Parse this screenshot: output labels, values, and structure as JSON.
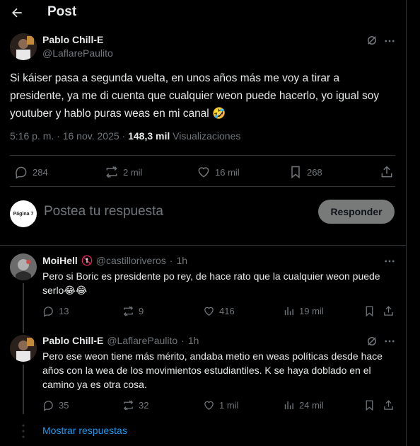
{
  "header": {
    "title": "Post"
  },
  "post": {
    "author_name": "Pablo Chill-E",
    "author_handle": "@LaflarePaulito",
    "text": "Si káiser pasa a segunda vuelta, en unos años más me voy a tirar a presidente, ya me di cuenta que cualquier weon puede hacerlo, yo igual soy youtuber y hablo puras weas en mi canal",
    "emoji": "🤣",
    "time": "5:16 p. m.",
    "sep1": " · ",
    "date": "16 nov. 2025",
    "sep2": " · ",
    "views": "148,3 mil",
    "views_label": " Visualizaciones",
    "replies": "284",
    "reposts": "2 mil",
    "likes": "16 mil",
    "bookmarks": "268"
  },
  "reply_box": {
    "avatar_text": "Página 7",
    "placeholder": "Postea tu respuesta",
    "button": "Responder"
  },
  "comments": [
    {
      "name": "MoiHell",
      "handle": "@castilloriveros",
      "sep": "·",
      "time": "1h",
      "text": "Pero si Boric es presidente po rey, de hace rato que la cualquier weon puede serlo😂😂",
      "replies": "13",
      "reposts": "9",
      "likes": "416",
      "views": "19 mil"
    },
    {
      "name": "Pablo Chill-E",
      "handle": "@LaflarePaulito",
      "sep": "·",
      "time": "1h",
      "text": "Pero ese weon tiene más mérito, andaba metio en weas políticas desde hace años con la wea de los movimientos estudiantiles. K se haya doblado en el camino ya es otra cosa.",
      "replies": "35",
      "reposts": "32",
      "likes": "1 mil",
      "views": "24 mil"
    }
  ],
  "show_more": "Mostrar respuestas",
  "colors": {
    "background": "#000000",
    "text": "#e7e9ea",
    "muted": "#71767b",
    "link": "#1d9bf0",
    "border": "#2f3336"
  },
  "icons": [
    "back-arrow-icon",
    "grok-icon",
    "more-icon",
    "reply-icon",
    "repost-icon",
    "like-icon",
    "bookmark-icon",
    "share-icon",
    "views-icon",
    "badge-icon"
  ]
}
